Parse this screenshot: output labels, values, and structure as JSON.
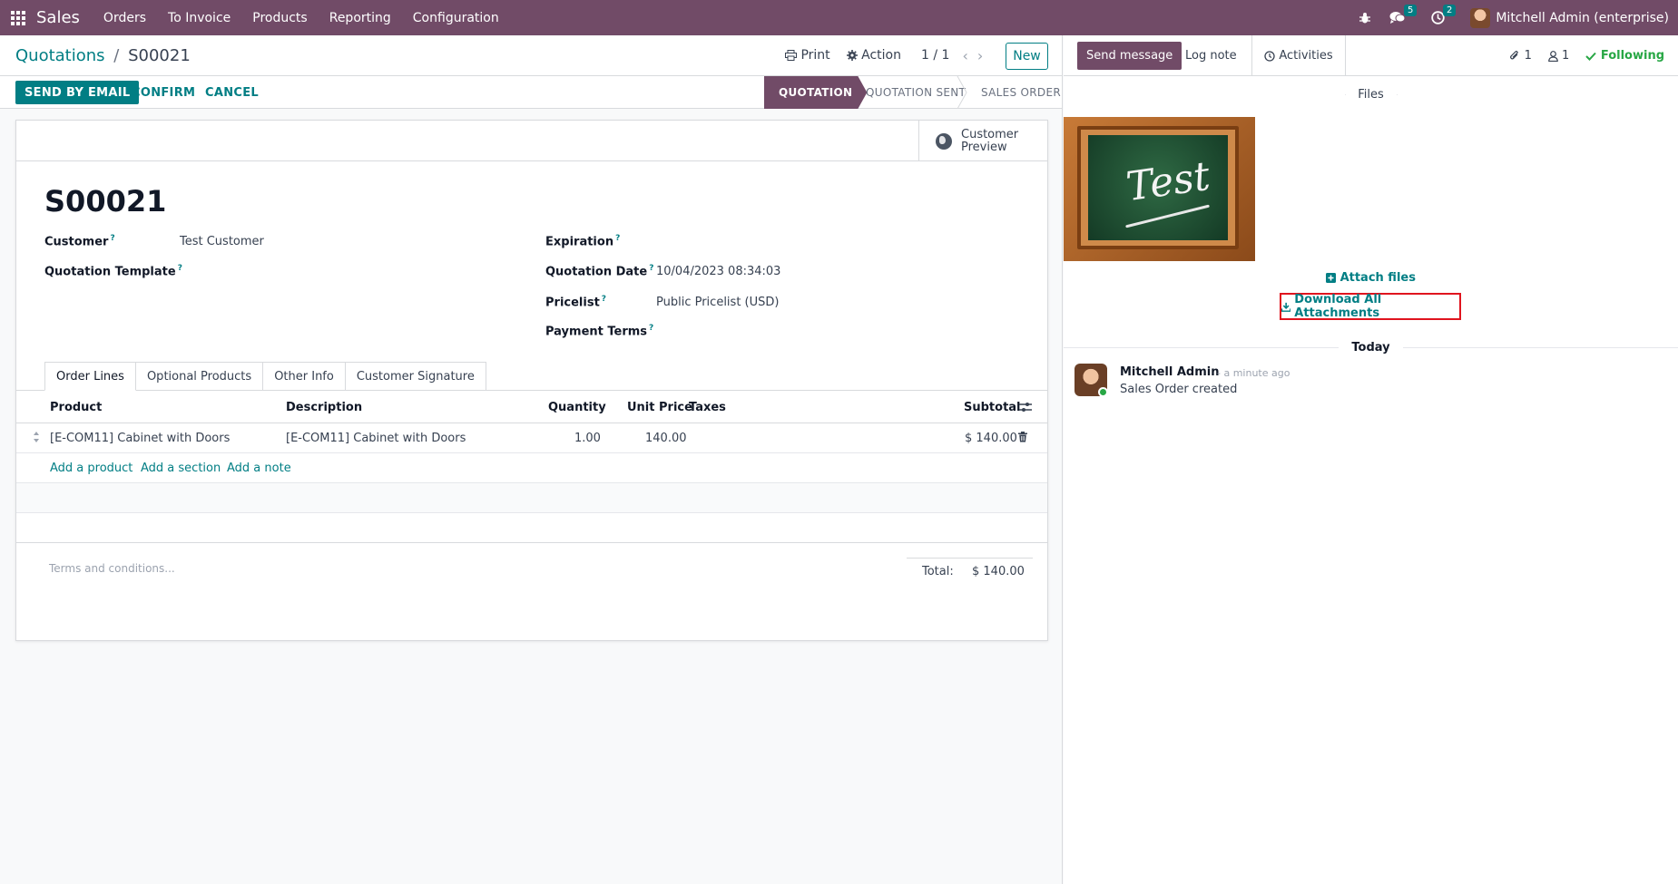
{
  "navbar": {
    "app_name": "Sales",
    "menu": [
      "Orders",
      "To Invoice",
      "Products",
      "Reporting",
      "Configuration"
    ],
    "messages_count": "5",
    "activities_count": "2",
    "user_name": "Mitchell Admin (enterprise)"
  },
  "control_panel": {
    "breadcrumb_parent": "Quotations",
    "breadcrumb_sep": "/",
    "breadcrumb_current": "S00021",
    "print_label": "Print",
    "action_label": "Action",
    "pager": "1 / 1",
    "new_label": "New"
  },
  "statusbar": {
    "send_email": "SEND BY EMAIL",
    "confirm": "CONFIRM",
    "cancel": "CANCEL",
    "stages": [
      "QUOTATION",
      "QUOTATION SENT",
      "SALES ORDER"
    ],
    "active_stage": "QUOTATION"
  },
  "form": {
    "preview_line1": "Customer",
    "preview_line2": "Preview",
    "title": "S00021",
    "customer_label": "Customer",
    "customer_value": "Test Customer",
    "template_label": "Quotation Template",
    "expiration_label": "Expiration",
    "quotation_date_label": "Quotation Date",
    "quotation_date_value": "10/04/2023 08:34:03",
    "pricelist_label": "Pricelist",
    "pricelist_value": "Public Pricelist (USD)",
    "payment_terms_label": "Payment Terms",
    "help_mark": "?"
  },
  "tabs": [
    "Order Lines",
    "Optional Products",
    "Other Info",
    "Customer Signature"
  ],
  "order_lines": {
    "columns": [
      "Product",
      "Description",
      "Quantity",
      "Unit Price",
      "Taxes",
      "Subtotal"
    ],
    "rows": [
      {
        "product": "[E-COM11] Cabinet with Doors",
        "description": "[E-COM11] Cabinet with Doors",
        "quantity": "1.00",
        "unit_price": "140.00",
        "taxes": "",
        "subtotal": "$ 140.00"
      }
    ],
    "add_product": "Add a product",
    "add_section": "Add a section",
    "add_note": "Add a note",
    "terms_placeholder": "Terms and conditions...",
    "total_label": "Total:",
    "total_value": "$ 140.00"
  },
  "chatter": {
    "send_message": "Send message",
    "log_note": "Log note",
    "activities": "Activities",
    "attachments_count": "1",
    "followers_count": "1",
    "following": "Following",
    "files_header": "Files",
    "attachment_image_text": "Test",
    "attach_files": "Attach files",
    "download_all": "Download All Attachments",
    "today_header": "Today",
    "message_author": "Mitchell Admin",
    "message_time": "- a minute ago",
    "message_body": "Sales Order created"
  },
  "colors": {
    "brand": "#714B67",
    "accent": "#017e84",
    "highlight_border": "#e0141e",
    "following": "#28a745"
  }
}
